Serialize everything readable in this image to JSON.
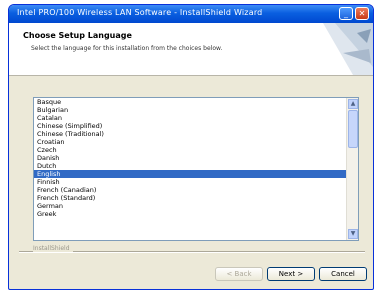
{
  "window": {
    "title": "Intel PRO/100 Wireless LAN Software - InstallShield Wizard",
    "minimize_glyph": "_",
    "close_glyph": "✕"
  },
  "header": {
    "title": "Choose Setup Language",
    "subtitle": "Select the language for this installation from the choices below."
  },
  "language_list": {
    "items": [
      "Basque",
      "Bulgarian",
      "Catalan",
      "Chinese (Simplified)",
      "Chinese (Traditional)",
      "Croatian",
      "Czech",
      "Danish",
      "Dutch",
      "English",
      "Finnish",
      "French (Canadian)",
      "French (Standard)",
      "German",
      "Greek"
    ],
    "selected_index": 9
  },
  "scrollbar": {
    "up_glyph": "▲",
    "down_glyph": "▼"
  },
  "footer": {
    "branding": "InstallShield"
  },
  "buttons": {
    "back": "< Back",
    "next": "Next >",
    "cancel": "Cancel"
  }
}
